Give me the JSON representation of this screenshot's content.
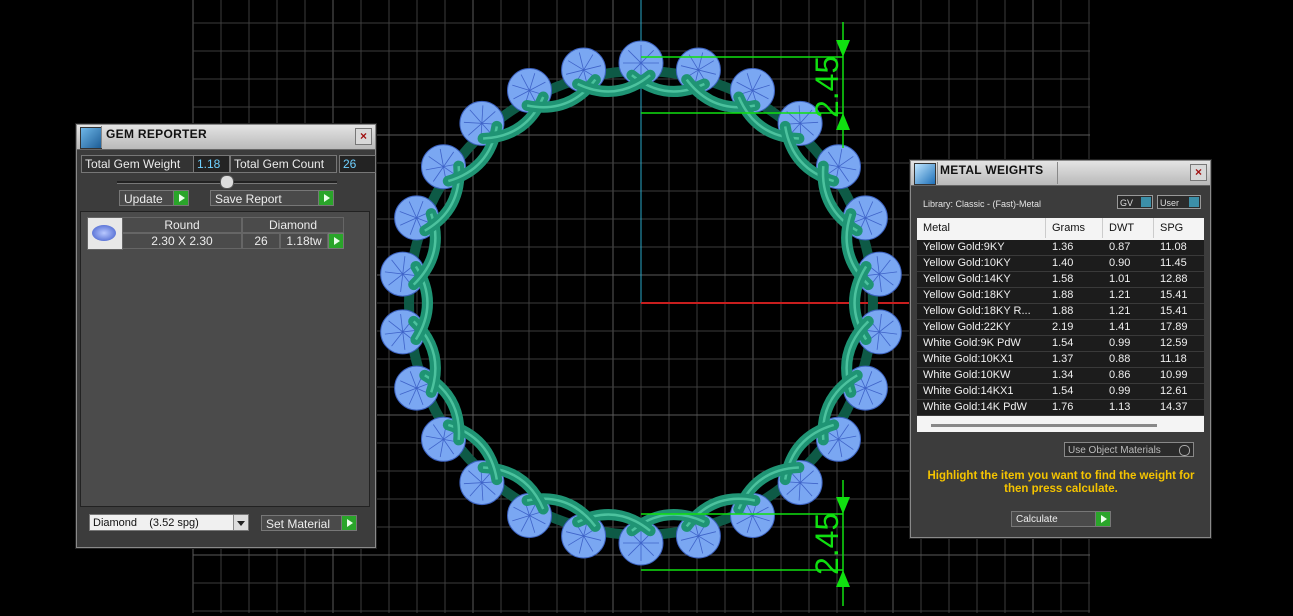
{
  "viewport": {
    "dimension_top": "2.45",
    "dimension_bottom": "2.45"
  },
  "gem_reporter": {
    "title": "GEM REPORTER",
    "close_glyph": "×",
    "total_gem_weight_label": "Total Gem Weight",
    "total_gem_weight_value": "1.18",
    "total_gem_count_label": "Total Gem Count",
    "total_gem_count_value": "26",
    "update_label": "Update",
    "save_report_label": "Save Report",
    "gem_row": {
      "shape": "Round",
      "material": "Diamond",
      "size": "2.30 X 2.30",
      "count": "26",
      "weight": "1.18tw"
    },
    "material_select_value": "Diamond    (3.52 spg)",
    "set_material_label": "Set Material"
  },
  "metal_weights": {
    "title": "METAL WEIGHTS",
    "close_glyph": "×",
    "library_label": "Library: Classic - (Fast)-Metal",
    "gv_label": "GV",
    "user_label": "User",
    "columns": [
      "Metal",
      "Grams",
      "DWT",
      "SPG"
    ],
    "rows": [
      {
        "metal": "Yellow Gold:9KY",
        "grams": "1.36",
        "dwt": "0.87",
        "spg": "11.08"
      },
      {
        "metal": "Yellow Gold:10KY",
        "grams": "1.40",
        "dwt": "0.90",
        "spg": "11.45"
      },
      {
        "metal": "Yellow Gold:14KY",
        "grams": "1.58",
        "dwt": "1.01",
        "spg": "12.88"
      },
      {
        "metal": "Yellow Gold:18KY",
        "grams": "1.88",
        "dwt": "1.21",
        "spg": "15.41"
      },
      {
        "metal": "Yellow Gold:18KY R...",
        "grams": "1.88",
        "dwt": "1.21",
        "spg": "15.41"
      },
      {
        "metal": "Yellow Gold:22KY",
        "grams": "2.19",
        "dwt": "1.41",
        "spg": "17.89"
      },
      {
        "metal": "White Gold:9K PdW",
        "grams": "1.54",
        "dwt": "0.99",
        "spg": "12.59"
      },
      {
        "metal": "White Gold:10KX1",
        "grams": "1.37",
        "dwt": "0.88",
        "spg": "11.18"
      },
      {
        "metal": "White Gold:10KW",
        "grams": "1.34",
        "dwt": "0.86",
        "spg": "10.99"
      },
      {
        "metal": "White Gold:14KX1",
        "grams": "1.54",
        "dwt": "0.99",
        "spg": "12.61"
      },
      {
        "metal": "White Gold:14K PdW",
        "grams": "1.76",
        "dwt": "1.13",
        "spg": "14.37"
      }
    ],
    "use_object_materials_label": "Use Object Materials",
    "instruction": "Highlight the item you want to find the weight for then press calculate.",
    "calculate_label": "Calculate"
  },
  "colors": {
    "grid": "#3d3d3d",
    "ring_metal": "#1f9474",
    "gems": "#7aa7f2",
    "dimension": "#10e010",
    "axis_x": "#c81e1e",
    "axis_y": "#2aa8c8",
    "instruction_text": "#f5c400"
  }
}
